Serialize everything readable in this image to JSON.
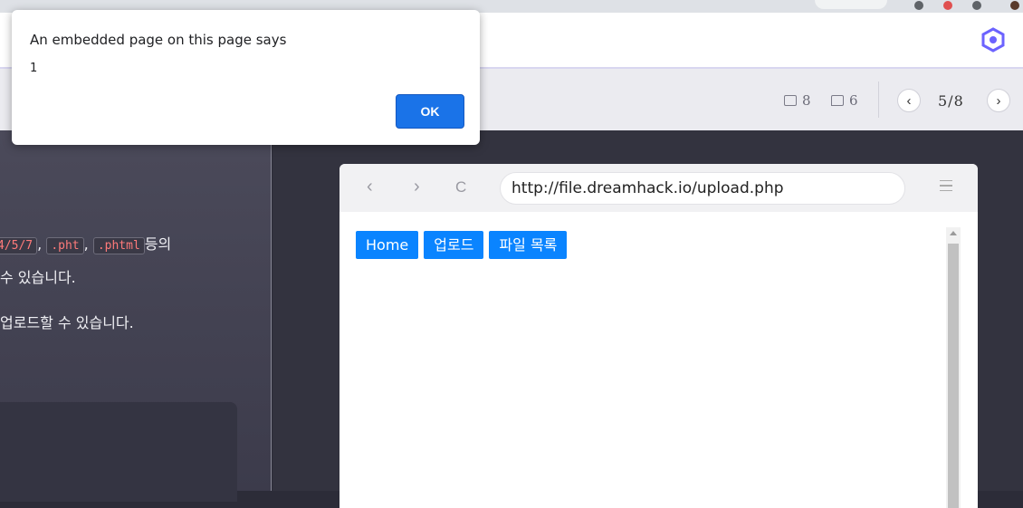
{
  "alert": {
    "title": "An embedded page on this page says",
    "message": "1",
    "ok_label": "OK"
  },
  "toolbar": {
    "question_count": "8",
    "comment_count": "6",
    "page_indicator": "5/8",
    "prev_icon": "chevron-left-icon",
    "next_icon": "chevron-right-icon"
  },
  "lecture": {
    "code_1": "4/5/7",
    "sep_1": ",",
    "code_2": ".pht",
    "sep_2": ",",
    "code_3": ".phtml",
    "text_1_tail": "등의",
    "text_2": "수 있습니다.",
    "text_3": "업로드할 수 있습니다."
  },
  "mock_browser": {
    "url": "http://file.dreamhack.io/upload.php",
    "back_icon": "‹",
    "forward_icon": "›",
    "reload_icon": "C",
    "nav_buttons": [
      "Home",
      "업로드",
      "파일 목록"
    ]
  },
  "colors": {
    "accent": "#1a73e8",
    "mock_button": "#0a84ff",
    "code_text": "#ff7a7a"
  }
}
